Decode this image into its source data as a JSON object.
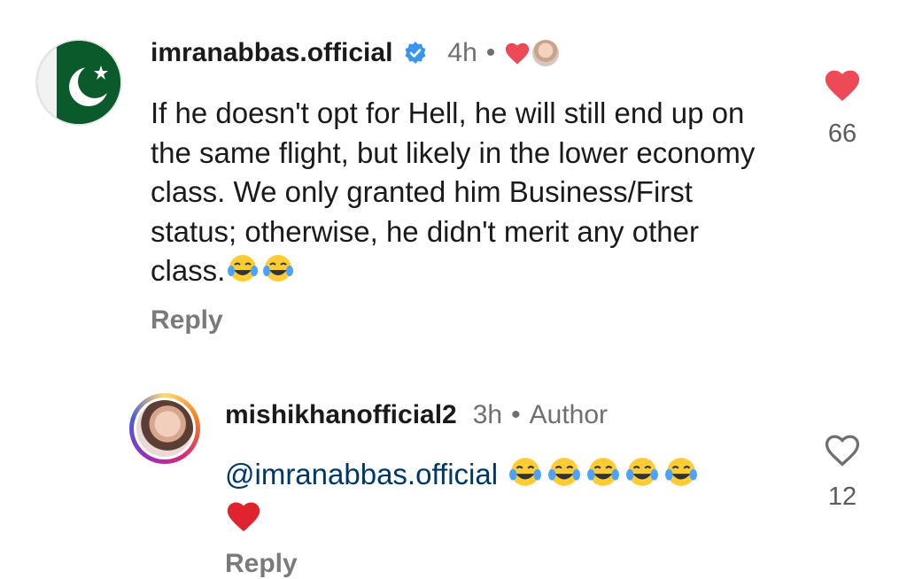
{
  "comments": [
    {
      "username": "imranabbas.official",
      "verified": true,
      "time": "4h",
      "author_liked": true,
      "text": "If he doesn't opt for Hell, he will still end up on the same flight, but likely in the lower economy class. We only granted him Business/First status; otherwise, he didn't merit any other class.",
      "emoji_count": 2,
      "reply_label": "Reply",
      "like_count": "66",
      "liked": true,
      "avatar_icon": "pakistan-flag-avatar"
    },
    {
      "username": "mishikhanofficial2",
      "time": "3h",
      "badge": "Author",
      "mention": "@imranabbas.official",
      "emoji_count": 5,
      "reply_label": "Reply",
      "like_count": "12",
      "liked": false,
      "avatar_icon": "profile-photo-avatar"
    }
  ],
  "colors": {
    "heart_red": "#ed4956",
    "verified_blue": "#3797f0",
    "mention_blue": "#00376b",
    "meta_gray": "#737373"
  }
}
